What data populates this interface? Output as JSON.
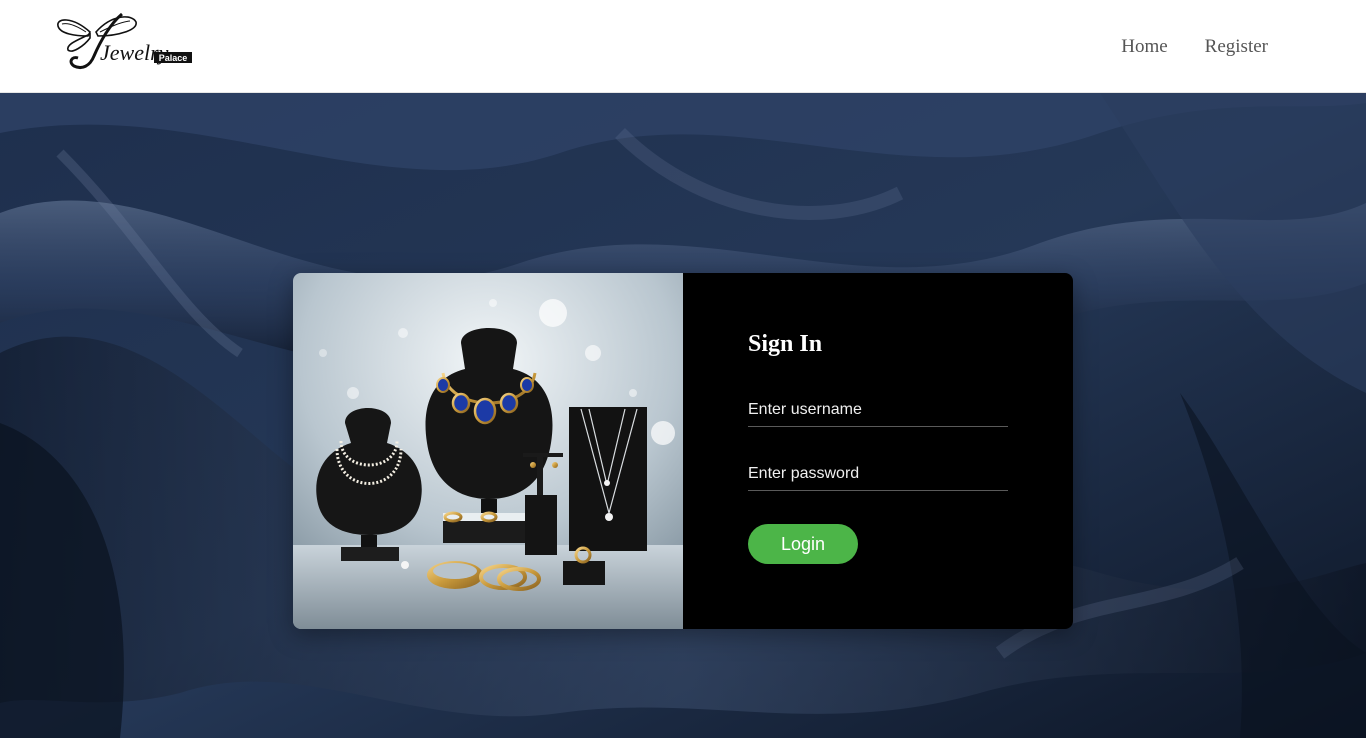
{
  "brand": {
    "logo_script": "Jewelry",
    "logo_tag": "Palace"
  },
  "nav": {
    "home_label": "Home",
    "register_label": "Register"
  },
  "login": {
    "title": "Sign In",
    "username_placeholder": "Enter username",
    "password_placeholder": "Enter password",
    "button_label": "Login"
  },
  "colors": {
    "header_bg": "#ffffff",
    "satin_bg": "#1b2a44",
    "form_bg": "#000000",
    "login_button": "#4cb548"
  },
  "icons": {
    "logo": "butterfly-logo-icon",
    "showcase": "jewelry-display-illustration"
  }
}
